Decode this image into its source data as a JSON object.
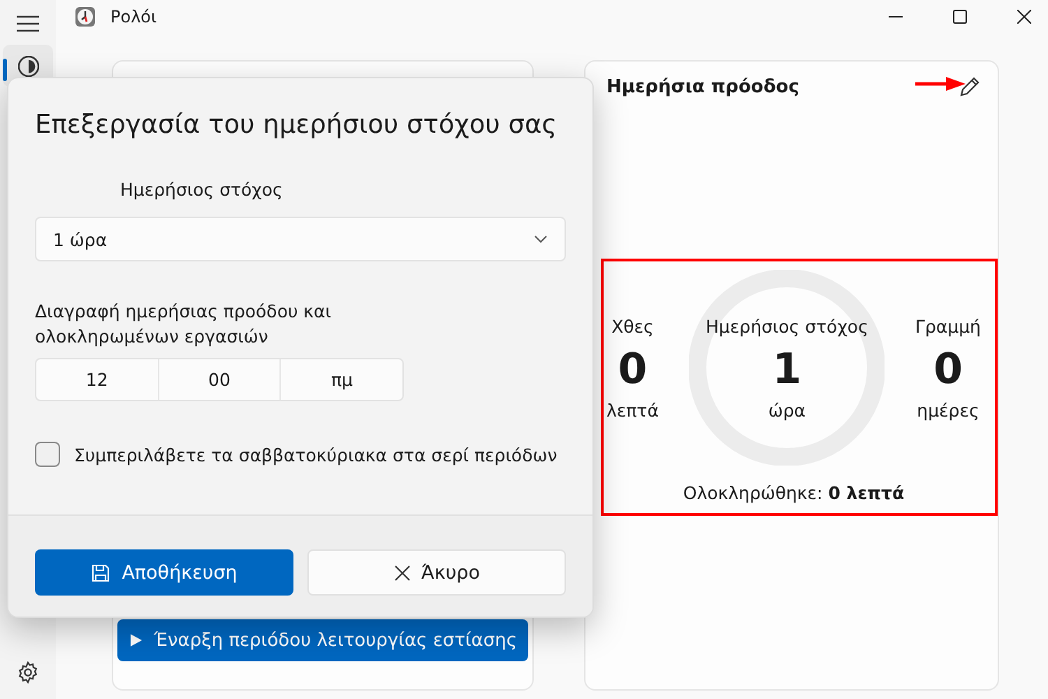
{
  "window": {
    "title": "Ρολόι"
  },
  "rail": {
    "items": [
      {
        "kind": "focus",
        "selected": true
      },
      {
        "kind": "settings",
        "selected": false
      }
    ]
  },
  "focus_card": {
    "start_button": "Έναρξη περιόδου λειτουργίας εστίασης"
  },
  "progress_card": {
    "title": "Ημερήσια πρόοδος",
    "stats": [
      {
        "kind": "side",
        "label": "Χθες",
        "value": "0",
        "unit": "λεπτά"
      },
      {
        "kind": "ring",
        "label": "Ημερήσιος στόχος",
        "value": "1",
        "unit": "ώρα",
        "level": 0
      },
      {
        "kind": "side",
        "label": "Γραμμή",
        "value": "0",
        "unit": "ημέρες"
      }
    ],
    "completed": "Ολοκληρώθηκε: **0 λεπτά**"
  },
  "dialog": {
    "title": "Επεξεργασία του ημερήσιου στόχου σας",
    "goal_label": "Ημερήσιος στόχος",
    "goal_value": "1 ώρα",
    "reset_label": "Διαγραφή ημερήσιας προόδου και ολοκληρωμένων εργασιών",
    "time": [
      "12",
      "00",
      "πμ"
    ],
    "weekends": {
      "label": "Συμπεριλάβετε τα σαββατοκύριακα στα σερί περιόδων",
      "checked": false
    },
    "save": "Αποθήκευση",
    "cancel": "Άκυρο"
  }
}
